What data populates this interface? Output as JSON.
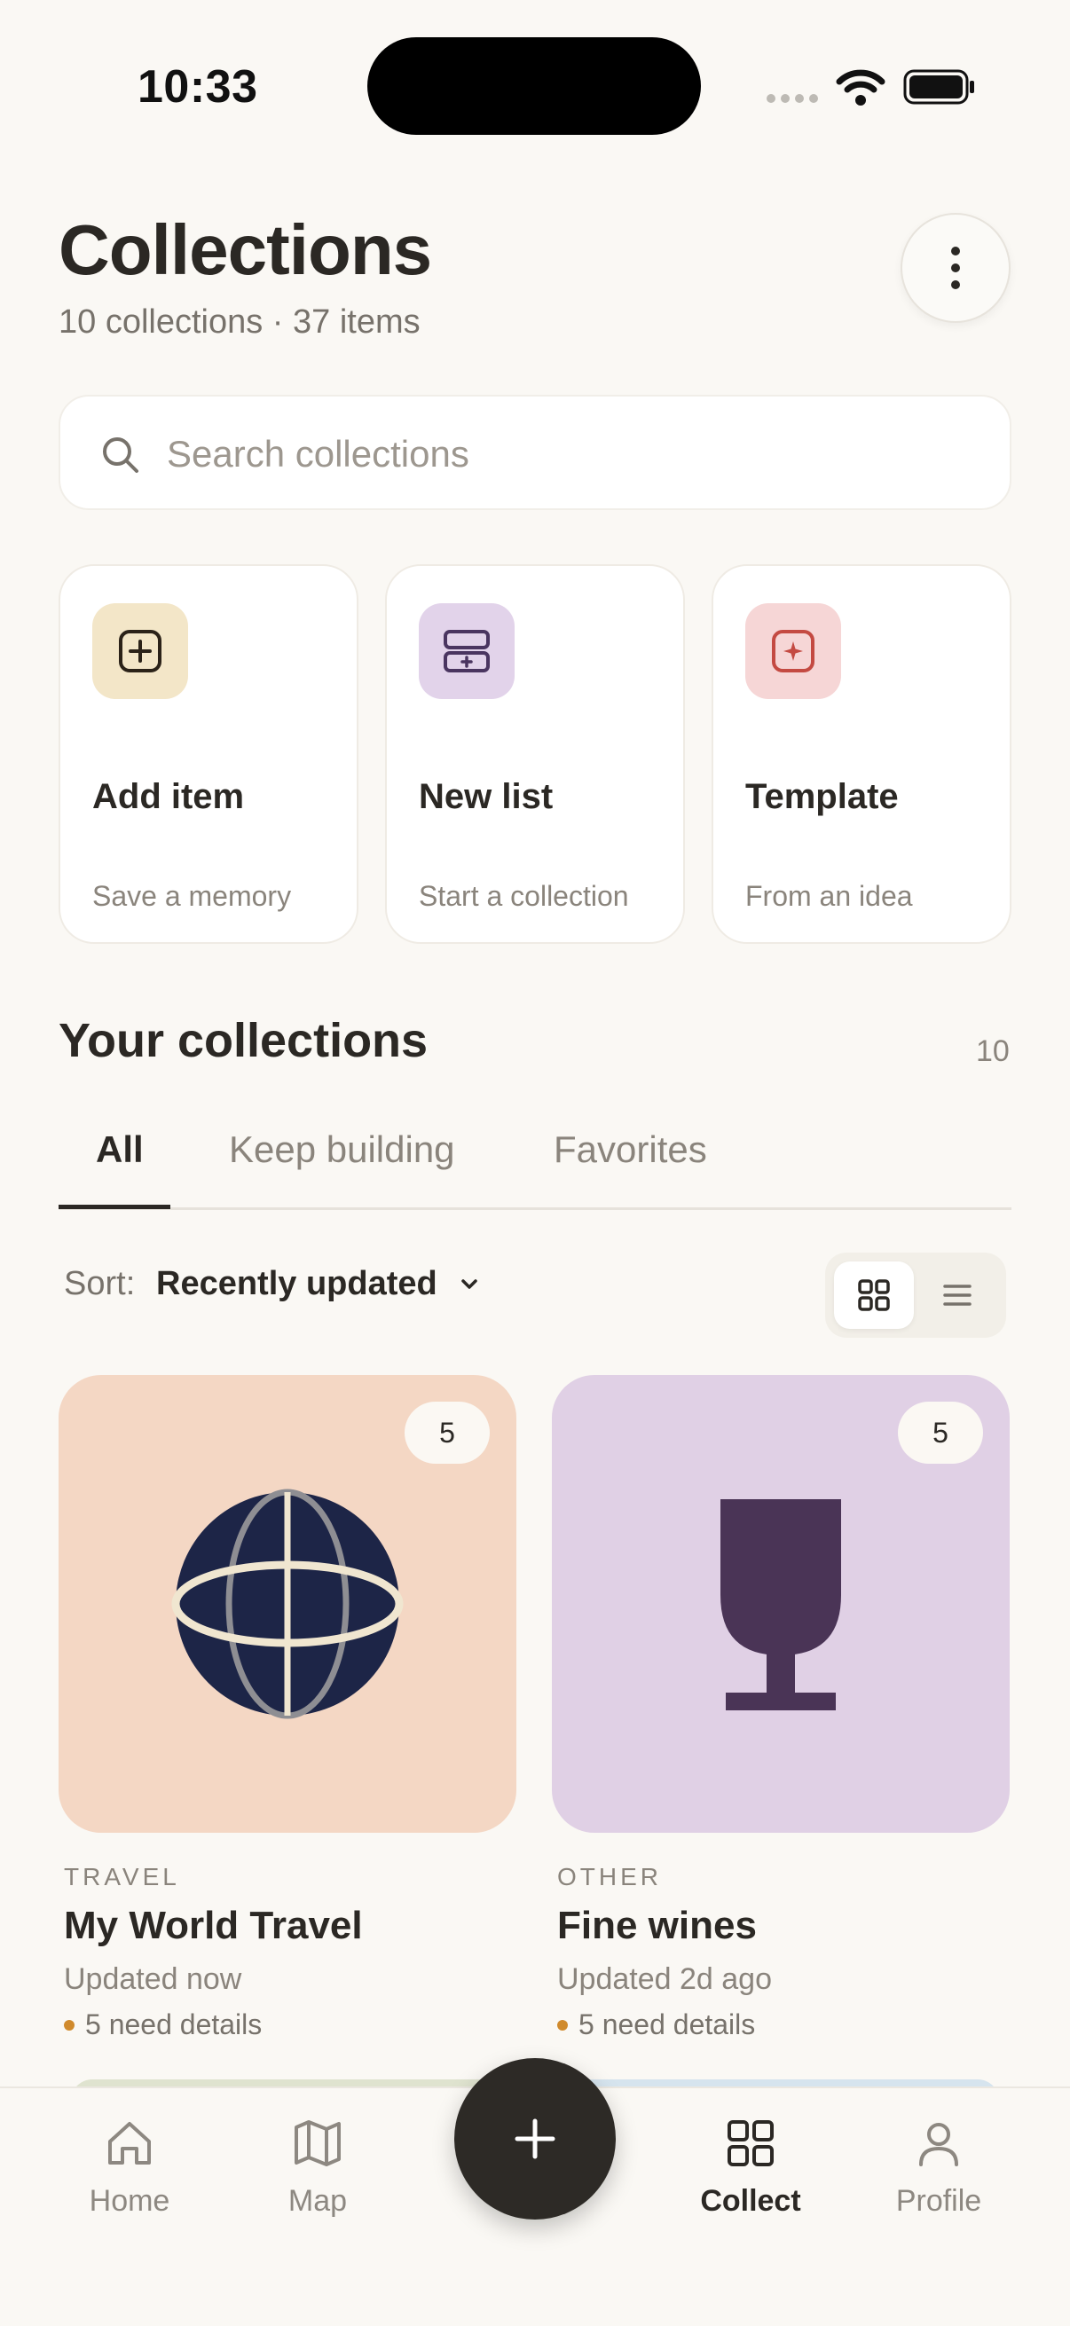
{
  "status_bar": {
    "time": "10:33"
  },
  "header": {
    "title": "Collections",
    "subtitle": "10 collections · 37 items",
    "more_icon": "more-vertical-icon"
  },
  "search": {
    "placeholder": "Search collections",
    "value": ""
  },
  "quick_actions": [
    {
      "title": "Add item",
      "subtitle": "Save a memory",
      "icon": "plus-square-icon",
      "color": "#f3e6c8"
    },
    {
      "title": "New list",
      "subtitle": "Start a collection",
      "icon": "stacked-list-icon",
      "color": "#e2d3ea"
    },
    {
      "title": "Template",
      "subtitle": "From an idea",
      "icon": "sparkle-icon",
      "color": "#f6d6d6"
    }
  ],
  "collections_section": {
    "title": "Your collections",
    "count": "10",
    "tabs": [
      "All",
      "Keep building",
      "Favorites"
    ],
    "active_tab": "All",
    "sort_label": "Sort:",
    "sort_value": "Recently updated",
    "view_mode": "grid"
  },
  "collections": [
    {
      "category": "TRAVEL",
      "title": "My World Travel",
      "updated": "Updated now",
      "needs": "5 need details",
      "count": "5",
      "icon": "globe-icon",
      "bg_color": "#f4d7c4"
    },
    {
      "category": "OTHER",
      "title": "Fine wines",
      "updated": "Updated 2d ago",
      "needs": "5 need details",
      "count": "5",
      "icon": "wine-glass-icon",
      "bg_color": "#e0d0e5"
    }
  ],
  "bottom_nav": {
    "items": [
      {
        "label": "Home",
        "icon": "home-icon"
      },
      {
        "label": "Map",
        "icon": "map-icon"
      },
      {
        "label": "Collect",
        "icon": "grid-icon",
        "active": true
      },
      {
        "label": "Profile",
        "icon": "profile-icon"
      }
    ],
    "fab_icon": "plus-icon"
  }
}
